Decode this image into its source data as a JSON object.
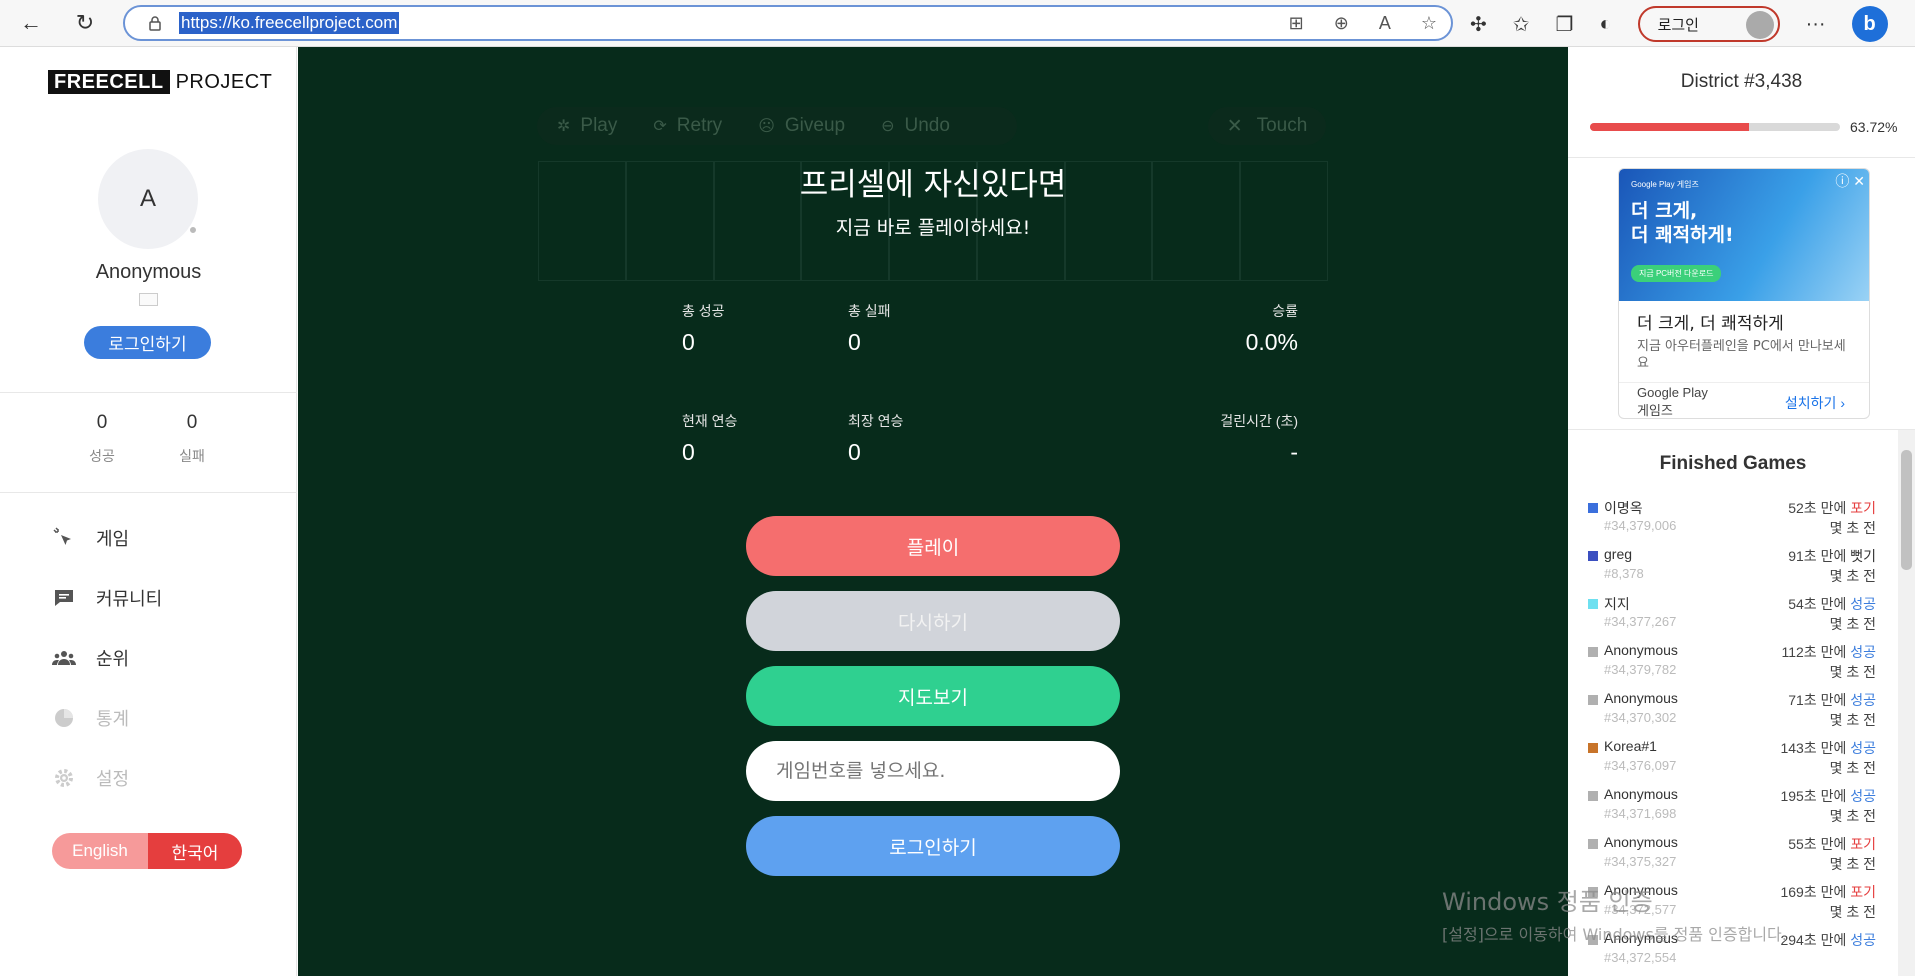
{
  "browser": {
    "url": "https://ko.freecellproject.com",
    "login_label": "로그인"
  },
  "sidebar": {
    "logo_box": "FREECELL",
    "logo_rest": "PROJECT",
    "avatar_letter": "A",
    "username": "Anonymous",
    "login_button": "로그인하기",
    "stats": [
      {
        "value": "0",
        "label": "성공"
      },
      {
        "value": "0",
        "label": "실패"
      }
    ],
    "menu": [
      {
        "label": "게임",
        "icon": "cursor-click-icon",
        "enabled": true
      },
      {
        "label": "커뮤니티",
        "icon": "chat-icon",
        "enabled": true
      },
      {
        "label": "순위",
        "icon": "people-icon",
        "enabled": true
      },
      {
        "label": "통계",
        "icon": "pie-chart-icon",
        "enabled": false
      },
      {
        "label": "설정",
        "icon": "gear-icon",
        "enabled": false
      }
    ],
    "lang": {
      "english": "English",
      "korean": "한국어"
    }
  },
  "main": {
    "toolbar": {
      "play": "Play",
      "retry": "Retry",
      "giveup": "Giveup",
      "undo": "Undo",
      "touch": "Touch"
    },
    "headline": "프리셀에 자신있다면",
    "subline": "지금 바로 플레이하세요!",
    "stats": {
      "total_success_label": "총 성공",
      "total_success": "0",
      "total_fail_label": "총 실패",
      "total_fail": "0",
      "win_rate_label": "승률",
      "win_rate": "0.0%",
      "current_streak_label": "현재 연승",
      "current_streak": "0",
      "best_streak_label": "최장 연승",
      "best_streak": "0",
      "time_label": "걸린시간 (초)",
      "time": "-"
    },
    "buttons": {
      "play": "플레이",
      "retry": "다시하기",
      "guide": "지도보기",
      "game_number_placeholder": "게임번호를 넣으세요.",
      "login": "로그인하기"
    }
  },
  "right": {
    "district": "District #3,438",
    "progress_pct": "63.72%",
    "progress_fraction": 0.6372,
    "ad": {
      "banner_small": "Google Play 게임즈",
      "banner_title": "더 크게,\n더 쾌적하게!",
      "banner_cta": "지금 PC버전 다운로드",
      "title": "더 크게, 더 쾌적하게",
      "desc": "지금 아우터플레인을 PC에서 만나보세요",
      "foot_line1": "Google Play",
      "foot_line2": "게임즈",
      "install": "설치하기"
    },
    "finished_title": "Finished Games",
    "games": [
      {
        "name": "이명옥",
        "id": "#34,379,006",
        "secs": "52초 만에",
        "result": "포기",
        "type": "fail",
        "ago": "몇 초 전",
        "color": "#3b6fdc"
      },
      {
        "name": "greg",
        "id": "#8,378",
        "secs": "91초 만에",
        "result": "뻣기",
        "type": "dark",
        "ago": "몇 초 전",
        "color": "#3b4fc0"
      },
      {
        "name": "지지",
        "id": "#34,377,267",
        "secs": "54초 만에",
        "result": "성공",
        "type": "ok",
        "ago": "몇 초 전",
        "color": "#6ee0f0"
      },
      {
        "name": "Anonymous",
        "id": "#34,379,782",
        "secs": "112초 만에",
        "result": "성공",
        "type": "ok",
        "ago": "몇 초 전",
        "color": "#b0b0b0"
      },
      {
        "name": "Anonymous",
        "id": "#34,370,302",
        "secs": "71초 만에",
        "result": "성공",
        "type": "ok",
        "ago": "몇 초 전",
        "color": "#b0b0b0"
      },
      {
        "name": "Korea#1",
        "id": "#34,376,097",
        "secs": "143초 만에",
        "result": "성공",
        "type": "ok",
        "ago": "몇 초 전",
        "color": "#c8742a"
      },
      {
        "name": "Anonymous",
        "id": "#34,371,698",
        "secs": "195초 만에",
        "result": "성공",
        "type": "ok",
        "ago": "몇 초 전",
        "color": "#b0b0b0"
      },
      {
        "name": "Anonymous",
        "id": "#34,375,327",
        "secs": "55초 만에",
        "result": "포기",
        "type": "fail",
        "ago": "몇 초 전",
        "color": "#b0b0b0"
      },
      {
        "name": "Anonymous",
        "id": "#34,372,577",
        "secs": "169초 만에",
        "result": "포기",
        "type": "fail",
        "ago": "몇 초 전",
        "color": "#b0b0b0"
      },
      {
        "name": "Anonymous",
        "id": "#34,372,554",
        "secs": "294초 만에",
        "result": "성공",
        "type": "ok",
        "ago": "",
        "color": "#b0b0b0"
      }
    ]
  },
  "watermark": {
    "line1": "Windows 정품 인증",
    "line2": "[설정]으로 이동하여 Windows를 정품 인증합니다."
  }
}
